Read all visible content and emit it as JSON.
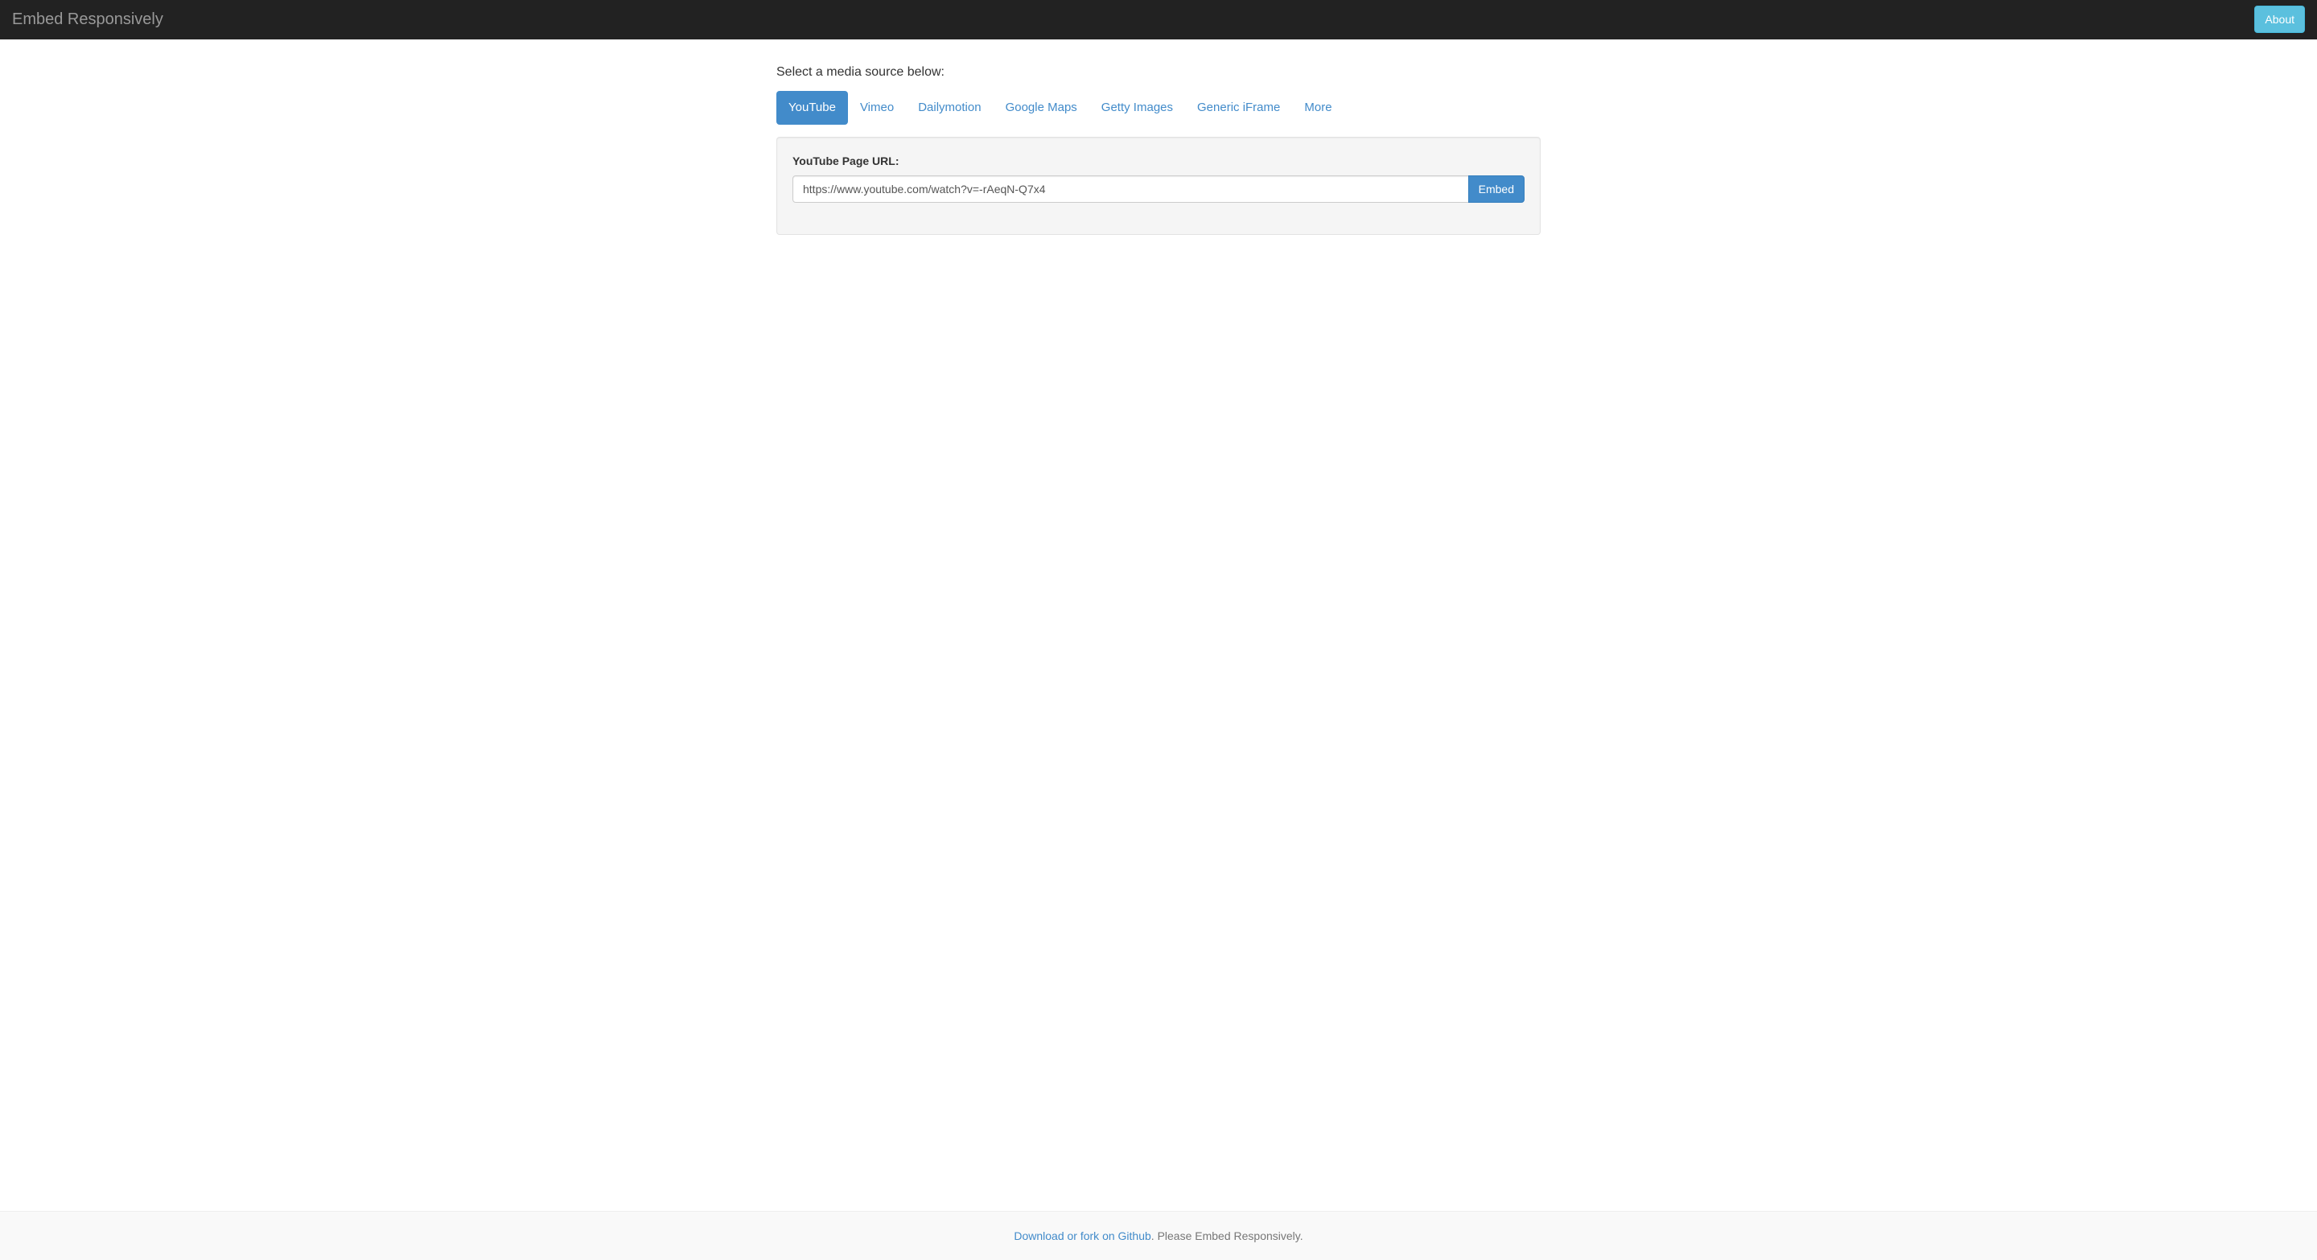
{
  "navbar": {
    "brand": "Embed Responsively",
    "about_label": "About"
  },
  "main": {
    "intro_text": "Select a media source below:",
    "tabs": [
      {
        "label": "YouTube",
        "active": true
      },
      {
        "label": "Vimeo",
        "active": false
      },
      {
        "label": "Dailymotion",
        "active": false
      },
      {
        "label": "Google Maps",
        "active": false
      },
      {
        "label": "Getty Images",
        "active": false
      },
      {
        "label": "Generic iFrame",
        "active": false
      },
      {
        "label": "More",
        "active": false
      }
    ],
    "form": {
      "label": "YouTube Page URL:",
      "value": "https://www.youtube.com/watch?v=-rAeqN-Q7x4",
      "button_label": "Embed"
    }
  },
  "footer": {
    "link_text": "Download or fork on Github",
    "suffix_text": ". Please Embed Responsively."
  }
}
